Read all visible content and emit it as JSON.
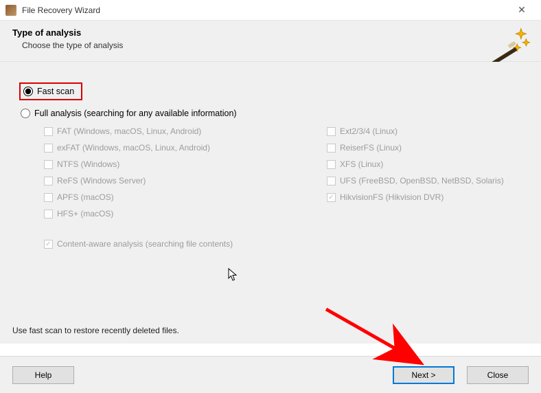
{
  "window": {
    "title": "File Recovery Wizard"
  },
  "header": {
    "heading": "Type of analysis",
    "subtitle": "Choose the type of analysis"
  },
  "analysis": {
    "fast_scan_label": "Fast scan",
    "full_analysis_label": "Full analysis (searching for any available information)",
    "selected": "fast_scan"
  },
  "filesystems": {
    "left": [
      {
        "label": "FAT (Windows, macOS, Linux, Android)",
        "checked": false
      },
      {
        "label": "exFAT (Windows, macOS, Linux, Android)",
        "checked": false
      },
      {
        "label": "NTFS (Windows)",
        "checked": false
      },
      {
        "label": "ReFS (Windows Server)",
        "checked": false
      },
      {
        "label": "APFS (macOS)",
        "checked": false
      },
      {
        "label": "HFS+ (macOS)",
        "checked": false
      }
    ],
    "right": [
      {
        "label": "Ext2/3/4 (Linux)",
        "checked": false
      },
      {
        "label": "ReiserFS (Linux)",
        "checked": false
      },
      {
        "label": "XFS (Linux)",
        "checked": false
      },
      {
        "label": "UFS (FreeBSD, OpenBSD, NetBSD, Solaris)",
        "checked": false
      },
      {
        "label": "HikvisionFS (Hikvision DVR)",
        "checked": true
      }
    ]
  },
  "content_aware": {
    "label": "Content-aware analysis (searching file contents)",
    "checked": true
  },
  "hint": "Use fast scan to restore recently deleted files.",
  "buttons": {
    "help": "Help",
    "next": "Next >",
    "close": "Close"
  }
}
